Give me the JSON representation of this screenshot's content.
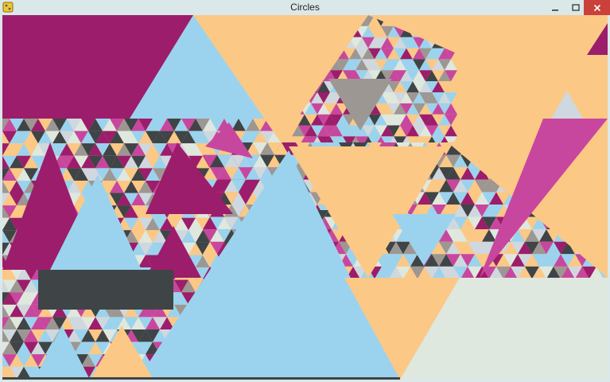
{
  "window": {
    "title": "Circles"
  },
  "icons": {
    "app": "python-icon",
    "minimize": "minimize-icon",
    "maximize": "maximize-icon",
    "close": "close-icon"
  },
  "colors": {
    "magenta": "#9c1d6b",
    "pink": "#c8479e",
    "sky": "#9bd3ef",
    "peach": "#fbc886",
    "charcoal": "#3f4447",
    "gray": "#9d9793",
    "mint": "#dfe8df",
    "pale": "#cfd8df"
  }
}
